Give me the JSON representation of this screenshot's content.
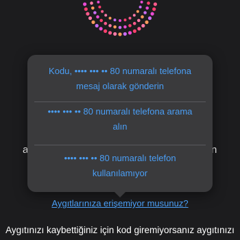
{
  "brand": {
    "logo_icon": "dotted-ring-logo-icon",
    "dot_colors": [
      "#ff5a8c",
      "#ff3f6e",
      "#e84bd3",
      "#c86cf2",
      "#ff9a5c",
      "#ff7aa6"
    ]
  },
  "background": {
    "left_fragment": "a",
    "right_fragment": "n"
  },
  "popover": {
    "options": [
      {
        "label_line1": "Kodu, •••• ••• •• 80 numaralı telefona",
        "label_line2": "mesaj olarak gönderin"
      },
      {
        "label_line1": "•••• ••• •• 80 numaralı telefona arama",
        "label_line2": "alın"
      },
      {
        "label_line1": "•••• ••• •• 80 numaralı telefon",
        "label_line2": "kullanılamıyor"
      }
    ]
  },
  "trouble_link": "Aygıtlarınıza erişemiyor musunuz?",
  "bottom_text": "Aygıtınızı kaybettiğiniz için kod giremiyorsanız aygıtınızı",
  "colors": {
    "background": "#1c1c1e",
    "popover": "#3a3a3c",
    "link": "#4a9ef5",
    "text": "#ffffff"
  }
}
